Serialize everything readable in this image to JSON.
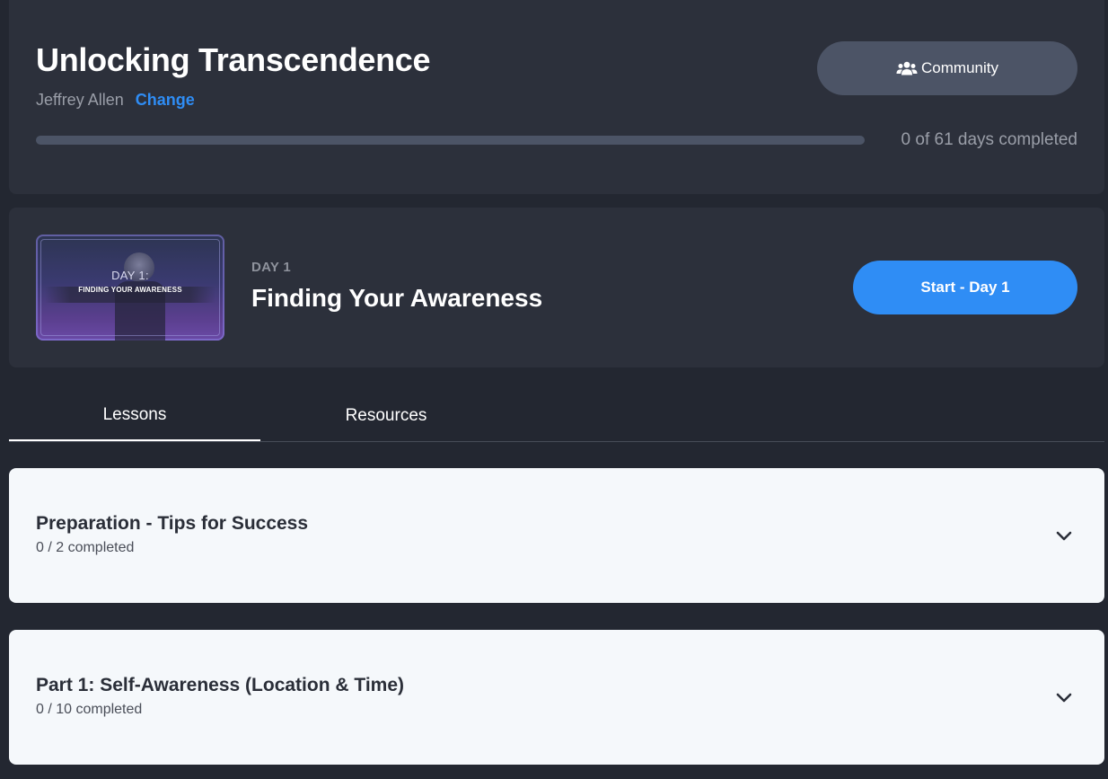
{
  "course": {
    "title": "Unlocking Transcendence",
    "instructor": "Jeffrey Allen",
    "change_label": "Change",
    "community_label": "Community",
    "community_icon": "users-icon",
    "progress": {
      "completed_days": 0,
      "total_days": 61,
      "label": "0 of 61 days completed"
    }
  },
  "current_day": {
    "thumbnail": {
      "day_text": "DAY 1:",
      "subtitle_text": "FINDING YOUR AWARENESS"
    },
    "label": "DAY 1",
    "title": "Finding Your Awareness",
    "start_label": "Start - Day 1"
  },
  "tabs": [
    {
      "label": "Lessons",
      "active": true
    },
    {
      "label": "Resources",
      "active": false
    }
  ],
  "sections": [
    {
      "title": "Preparation - Tips for Success",
      "progress": "0 / 2 completed"
    },
    {
      "title": "Part 1: Self-Awareness (Location & Time)",
      "progress": "0 / 10 completed"
    }
  ],
  "colors": {
    "background": "#232731",
    "card": "#2c303b",
    "accent": "#2f8df5",
    "muted_button": "#4c5466",
    "section_card": "#f5f8fb"
  }
}
